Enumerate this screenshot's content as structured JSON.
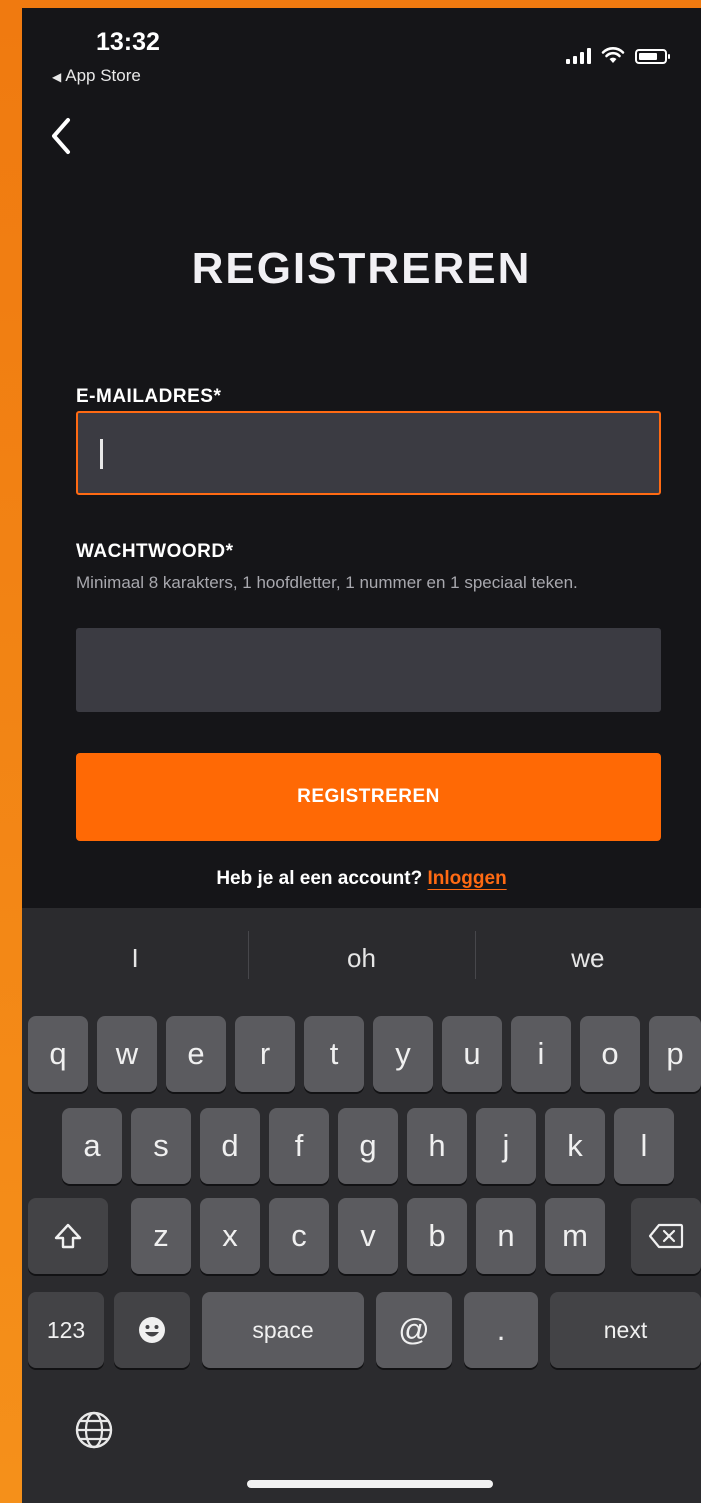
{
  "status_bar": {
    "time": "13:32",
    "back_app": "App Store",
    "battery_level": 0.75,
    "icons": [
      "signal-icon",
      "wifi-icon",
      "battery-icon"
    ]
  },
  "nav": {
    "back_icon": "chevron-left-icon"
  },
  "page": {
    "title": "REGISTREREN",
    "email_label": "E-MAILADRES*",
    "email_value": "",
    "password_label": "WACHTWOORD*",
    "password_hint": "Minimaal 8 karakters, 1 hoofdletter, 1 nummer en 1 speciaal teken.",
    "password_value": "",
    "register_button": "REGISTREREN",
    "account_question": "Heb je al een account?",
    "login_link": "Inloggen"
  },
  "keyboard": {
    "suggestions": [
      "I",
      "oh",
      "we"
    ],
    "row1": [
      "q",
      "w",
      "e",
      "r",
      "t",
      "y",
      "u",
      "i",
      "o",
      "p"
    ],
    "row2": [
      "a",
      "s",
      "d",
      "f",
      "g",
      "h",
      "j",
      "k",
      "l"
    ],
    "row3": [
      "z",
      "x",
      "c",
      "v",
      "b",
      "n",
      "m"
    ],
    "numbers_key": "123",
    "space_key": "space",
    "at_key": "@",
    "dot_key": ".",
    "next_key": "next"
  },
  "colors": {
    "accent": "#ff6905",
    "background": "#151518",
    "field": "#3b3b42"
  }
}
